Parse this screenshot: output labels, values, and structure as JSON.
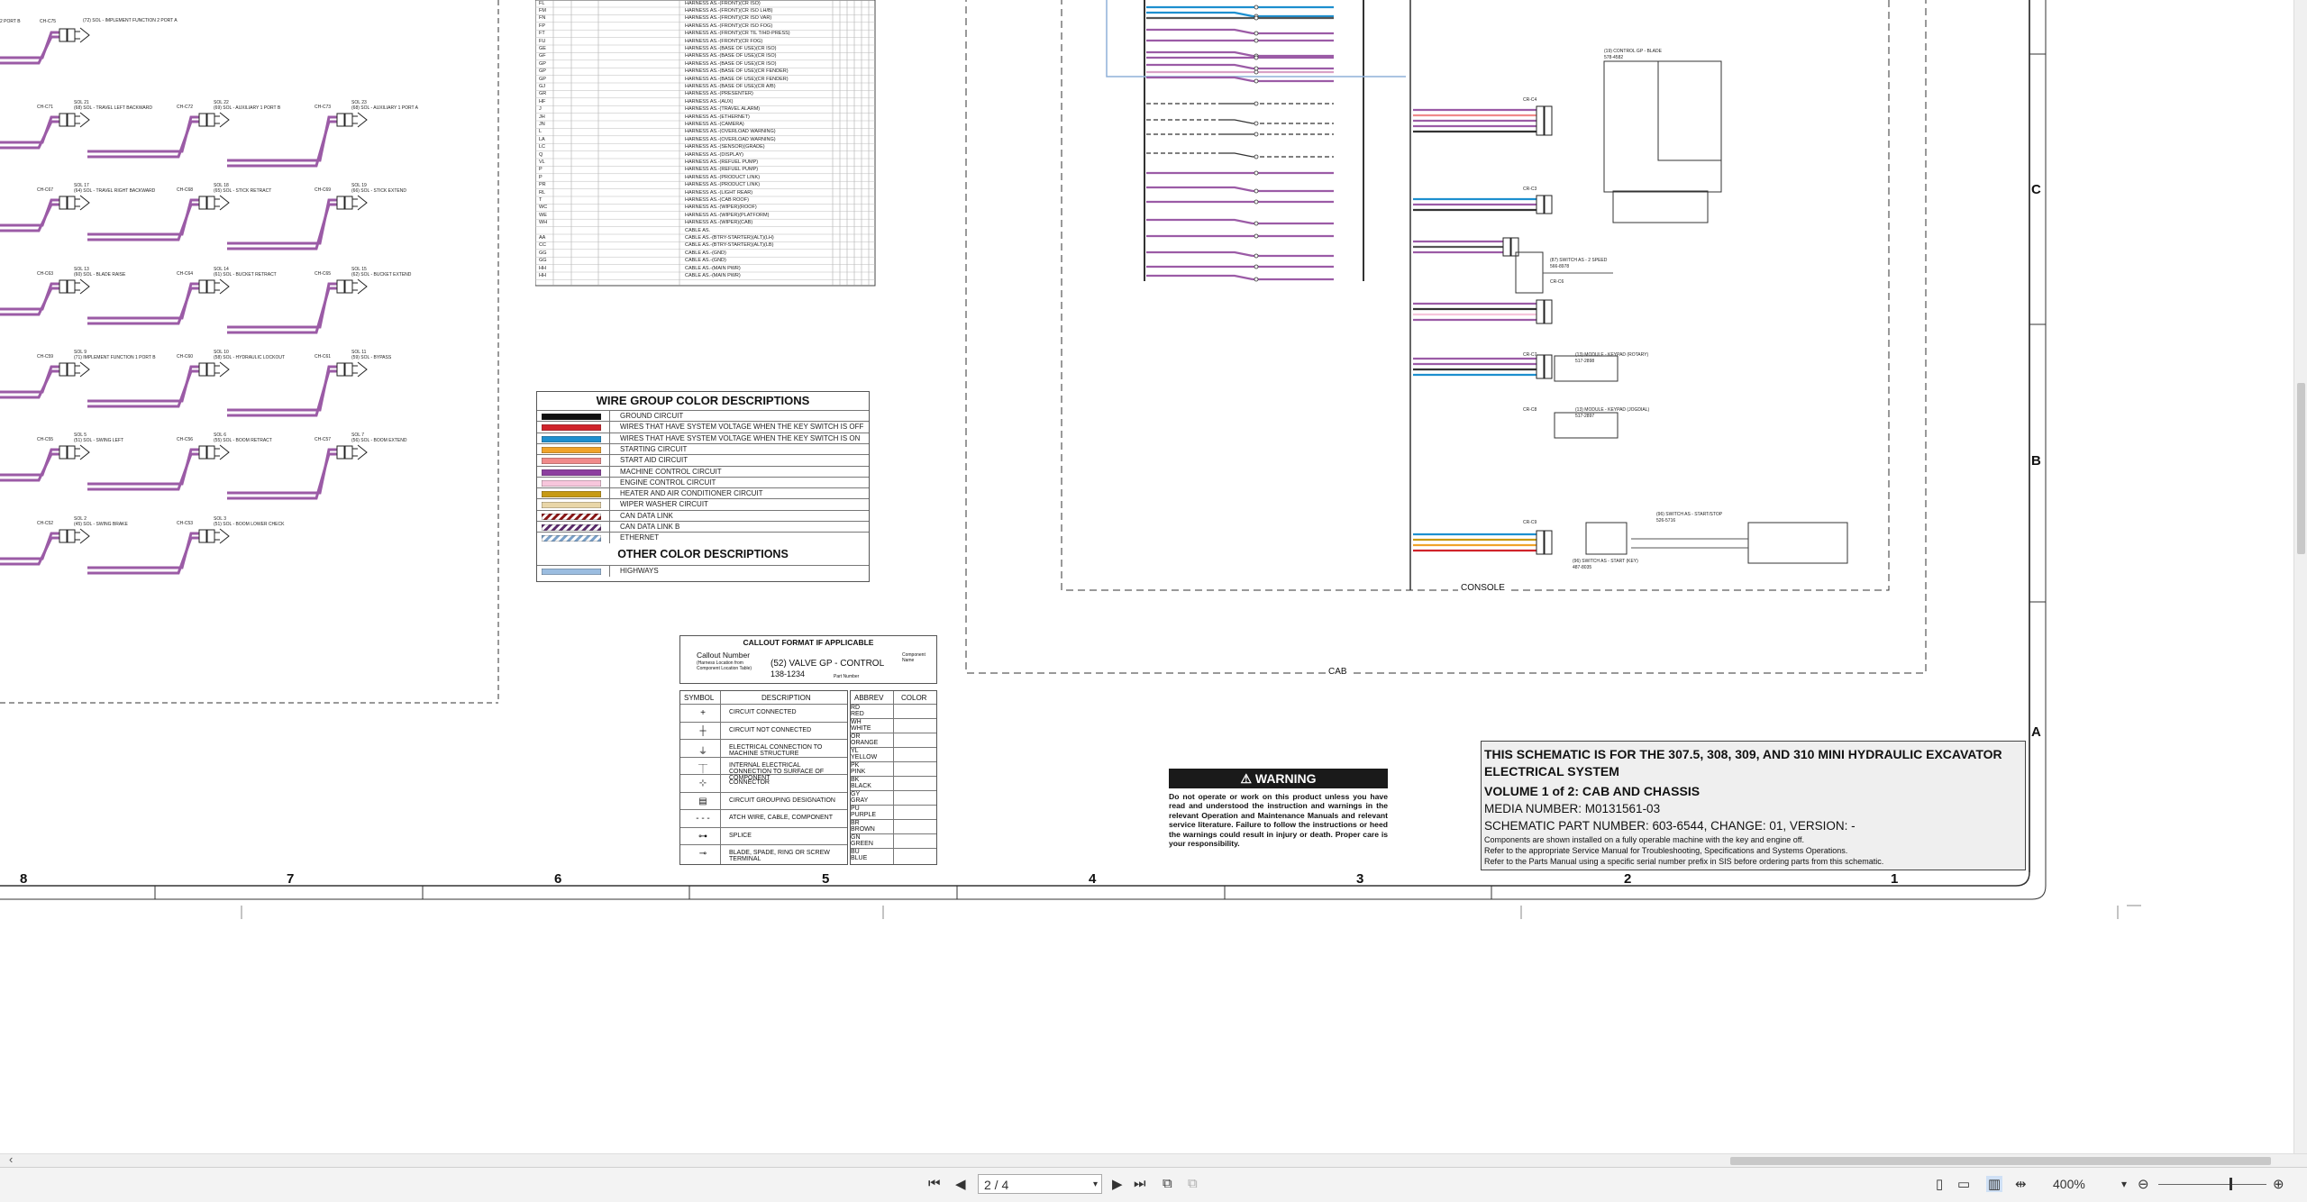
{
  "wire_group": {
    "title": "WIRE GROUP COLOR DESCRIPTIONS",
    "items": [
      {
        "label": "GROUND CIRCUIT",
        "color": "#111111"
      },
      {
        "label": "WIRES THAT HAVE SYSTEM VOLTAGE WHEN THE KEY SWITCH IS OFF",
        "color": "#d0232a"
      },
      {
        "label": "WIRES THAT HAVE SYSTEM VOLTAGE WHEN THE KEY SWITCH IS ON",
        "color": "#1d8fcf"
      },
      {
        "label": "STARTING CIRCUIT",
        "color": "#f0a32a"
      },
      {
        "label": "START AID CIRCUIT",
        "color": "#f08a8a"
      },
      {
        "label": "MACHINE CONTROL CIRCUIT",
        "color": "#8d3fa0"
      },
      {
        "label": "ENGINE CONTROL CIRCUIT",
        "color": "#f7c6dc"
      },
      {
        "label": "HEATER AND AIR CONDITIONER CIRCUIT",
        "color": "#c79a14"
      },
      {
        "label": "WIPER WASHER CIRCUIT",
        "color": "#e9d6a8"
      },
      {
        "label": "CAN DATA LINK",
        "color": "hatch-red"
      },
      {
        "label": "CAN DATA LINK B",
        "color": "hatch-purple"
      },
      {
        "label": "ETHERNET",
        "color": "hatch-blue"
      }
    ],
    "other_title": "OTHER COLOR DESCRIPTIONS",
    "other_items": [
      {
        "label": "HIGHWAYS",
        "color": "#9bbde0"
      }
    ]
  },
  "callout": {
    "title": "CALLOUT FORMAT IF APPLICABLE",
    "callout_number": "Callout Number",
    "callout_note": "(Harness Location from Component Location Table)",
    "example": "(52) VALVE GP - CONTROL",
    "part": "138-1234",
    "component_name": "Component Name",
    "part_number": "Part Number"
  },
  "symbols": {
    "header_symbol": "SYMBOL",
    "header_desc": "DESCRIPTION",
    "rows": [
      {
        "sym": "+",
        "desc": "CIRCUIT CONNECTED"
      },
      {
        "sym": "┼",
        "desc": "CIRCUIT NOT CONNECTED"
      },
      {
        "sym": "⏚",
        "desc": "ELECTRICAL CONNECTION TO MACHINE STRUCTURE"
      },
      {
        "sym": "⏉",
        "desc": "INTERNAL ELECTRICAL CONNECTION TO SURFACE OF COMPONENT"
      },
      {
        "sym": "⊹",
        "desc": "CONNECTOR"
      },
      {
        "sym": "▤",
        "desc": "CIRCUIT GROUPING DESIGNATION"
      },
      {
        "sym": "- - -",
        "desc": "ATCH WIRE, CABLE, COMPONENT"
      },
      {
        "sym": "⊶",
        "desc": "SPLICE"
      },
      {
        "sym": "⊸",
        "desc": "BLADE, SPADE, RING OR SCREW TERMINAL"
      }
    ]
  },
  "colors_table": {
    "header_abbrev": "ABBREV",
    "header_color": "COLOR",
    "rows": [
      [
        "RD",
        "RED"
      ],
      [
        "WH",
        "WHITE"
      ],
      [
        "OR",
        "ORANGE"
      ],
      [
        "YL",
        "YELLOW"
      ],
      [
        "PK",
        "PINK"
      ],
      [
        "BK",
        "BLACK"
      ],
      [
        "GY",
        "GRAY"
      ],
      [
        "PU",
        "PURPLE"
      ],
      [
        "BR",
        "BROWN"
      ],
      [
        "GN",
        "GREEN"
      ],
      [
        "BU",
        "BLUE"
      ]
    ]
  },
  "warning": {
    "title": "⚠ WARNING",
    "text": "Do not operate or work on this product unless you have read and understood the instruction and warnings in the relevant Operation and Maintenance Manuals and relevant service literature. Failure to follow the instructions or heed the warnings could result in injury or death. Proper care is your responsibility."
  },
  "title_block": {
    "line1": "THIS SCHEMATIC IS FOR THE 307.5, 308, 309, AND 310 MINI HYDRAULIC EXCAVATOR",
    "line2": "ELECTRICAL SYSTEM",
    "line3": "VOLUME 1 of 2: CAB AND CHASSIS",
    "line4": "MEDIA NUMBER: M0131561-03",
    "line5": "SCHEMATIC PART NUMBER: 603-6544, CHANGE: 01, VERSION: -",
    "line6": "Components are shown installed on a fully operable machine with the key and engine off.",
    "line7": "Refer to the appropriate Service Manual for Troubleshooting, Specifications and Systems Operations.",
    "line8": "Refer to the Parts Manual using a specific serial number prefix in SIS before ordering parts from this schematic."
  },
  "zones_bottom": [
    "8",
    "7",
    "6",
    "5",
    "4",
    "3",
    "2",
    "1"
  ],
  "zones_right": [
    "C",
    "B",
    "A"
  ],
  "frame_labels": {
    "console": "CONSOLE",
    "cab": "CAB"
  },
  "solenoids": [
    {
      "conn": "CH-C75",
      "sol": "(72) SOL - IMPLEMENT FUNCTION 2 PORT A",
      "left": "2 PORT B"
    },
    {
      "conn": "CH-C71",
      "sol": "SOL 21",
      "name": "(68) SOL - TRAVEL LEFT BACKWARD",
      "conn2": "CH-C72",
      "sol2": "SOL 22",
      "name2": "(69) SOL - AUXILIARY 1 PORT B",
      "conn3": "CH-C73",
      "sol3": "SOL 23",
      "name3": "(68) SOL - AUXILIARY 1 PORT A"
    },
    {
      "conn": "CH-C67",
      "sol": "SOL 17",
      "name": "(64) SOL - TRAVEL RIGHT BACKWARD",
      "conn2": "CH-C68",
      "sol2": "SOL 18",
      "name2": "(65) SOL - STICK RETRACT",
      "conn3": "CH-C69",
      "sol3": "SOL 19",
      "name3": "(66) SOL - STICK EXTEND"
    },
    {
      "conn": "CH-C63",
      "sol": "SOL 13",
      "name": "(60) SOL - BLADE RAISE",
      "conn2": "CH-C64",
      "sol2": "SOL 14",
      "name2": "(61) SOL - BUCKET RETRACT",
      "conn3": "CH-C65",
      "sol3": "SOL 15",
      "name3": "(62) SOL - BUCKET EXTEND"
    },
    {
      "conn": "CH-C59",
      "sol": "SOL 9",
      "name": "(71) IMPLEMENT FUNCTION 1 PORT B",
      "conn2": "CH-C60",
      "sol2": "SOL 10",
      "name2": "(58) SOL - HYDRAULIC LOCKOUT",
      "conn3": "CH-C61",
      "sol3": "SOL 11",
      "name3": "(59) SOL - BYPASS"
    },
    {
      "conn": "CH-C55",
      "sol": "SOL 5",
      "name": "(51) SOL - SWING LEFT",
      "conn2": "CH-C56",
      "sol2": "SOL 6",
      "name2": "(55) SOL - BOOM RETRACT",
      "conn3": "CH-C57",
      "sol3": "SOL 7",
      "name3": "(56) SOL - BOOM EXTEND"
    },
    {
      "conn": "CH-C52",
      "sol": "SOL 2",
      "name": "(45) SOL - SWING BRAKE",
      "conn2": "CH-C53",
      "sol2": "SOL 3",
      "name2": "(51) SOL - BOOM LOWER CHECK"
    }
  ],
  "harness_table": {
    "rows": [
      [
        "FL",
        "HARNESS AS.-(FRONT)(CR ISO)"
      ],
      [
        "FM",
        "HARNESS AS.-(FRONT)(CR ISO LH/B)"
      ],
      [
        "FN",
        "HARNESS AS.-(FRONT)(CR ISO VAR)"
      ],
      [
        "FP",
        "HARNESS AS.-(FRONT)(CR ISO FOG)"
      ],
      [
        "FT",
        "HARNESS AS.-(FRONT)(CR TIL T/HD-PRESS)"
      ],
      [
        "FU",
        "HARNESS AS.-(FRONT)(CR FOG)"
      ],
      [
        "GE",
        "HARNESS AS.-(BASE OF USE)(CR ISO)"
      ],
      [
        "GF",
        "HARNESS AS.-(BASE OF USE)(CR ISO)"
      ],
      [
        "GP",
        "HARNESS AS.-(BASE OF USE)(CR ISO)"
      ],
      [
        "GP",
        "HARNESS AS.-(BASE OF USE)(CR FENDER)"
      ],
      [
        "GP",
        "HARNESS AS.-(BASE OF USE)(CR FENDER)"
      ],
      [
        "GJ",
        "HARNESS AS.-(BASE OF USE)(CR A/B)"
      ],
      [
        "GR",
        "HARNESS AS.-(PRESENTER)"
      ],
      [
        "HF",
        "HARNESS AS.-(AUX)"
      ],
      [
        "J",
        "HARNESS AS.-(TRAVEL ALARM)"
      ],
      [
        "JH",
        "HARNESS AS.-(ETHERNET)"
      ],
      [
        "JN",
        "HARNESS AS.-(CAMERA)"
      ],
      [
        "L",
        "HARNESS AS.-(OVERLOAD WARNING)"
      ],
      [
        "LA",
        "HARNESS AS.-(OVERLOAD WARNING)"
      ],
      [
        "LC",
        "HARNESS AS.-(SENSOR)(GRADE)"
      ],
      [
        "Q",
        "HARNESS AS.-(DISPLAY)"
      ],
      [
        "VL",
        "HARNESS AS.-(REFUEL PUMP)"
      ],
      [
        "P",
        "HARNESS AS.-(REFUEL PUMP)"
      ],
      [
        "P",
        "HARNESS AS.-(PRODUCT LINK)"
      ],
      [
        "PR",
        "HARNESS AS.-(PRODUCT LINK)"
      ],
      [
        "RL",
        "HARNESS AS.-(LIGHT REAR)"
      ],
      [
        "T",
        "HARNESS AS.-(CAB ROOF)"
      ],
      [
        "WC",
        "HARNESS AS.-(WIPER)(ROOF)"
      ],
      [
        "WE",
        "HARNESS AS.-(WIPER)(PLATFORM)"
      ],
      [
        "WH",
        "HARNESS AS.-(WIPER)(CAB)"
      ],
      [
        "",
        "CABLE AS."
      ],
      [
        "AA",
        "CABLE AS.-(BTRY-STARTER)(ALT)(LH)"
      ],
      [
        "CC",
        "CABLE AS.-(BTRY-STARTER)(ALT)(LB)"
      ],
      [
        "GG",
        "CABLE AS.-(GND)"
      ],
      [
        "GG",
        "CABLE AS.-(GND)"
      ],
      [
        "HH",
        "CABLE AS.-(MAIN PWR)"
      ],
      [
        "HH",
        "CABLE AS.-(MAIN PWR)"
      ]
    ]
  },
  "components": {
    "control_gp": "(19) CONTROL GP - BLADE",
    "control_gp_pn": "578-4582",
    "switch_speed": "(87) SWITCH AS - 2 SPEED",
    "switch_speed_pn": "566-8978",
    "keypad_rotary": "(13) MODULE - KEYPAD (ROTARY)",
    "keypad_rotary_pn": "517-2898",
    "keypad_joggle": "(13) MODULE - KEYPAD (JOGDIAL)",
    "keypad_joggle_pn": "517-2897",
    "switch_startstop": "(96) SWITCH AS - START/STOP",
    "switch_startstop_pn": "526-5716",
    "switch_key": "(96) SWITCH AS - START (KEY)",
    "switch_key_pn": "487-8035",
    "conn_c4": "CR-C4",
    "conn_c3": "CR-C3",
    "conn_c6": "CR-C6",
    "conn_c7": "CR-C7",
    "conn_c8": "CR-C8",
    "conn_c9": "CR-C9"
  },
  "toolbar": {
    "page_value": "2 / 4",
    "zoom_value": "400%"
  }
}
